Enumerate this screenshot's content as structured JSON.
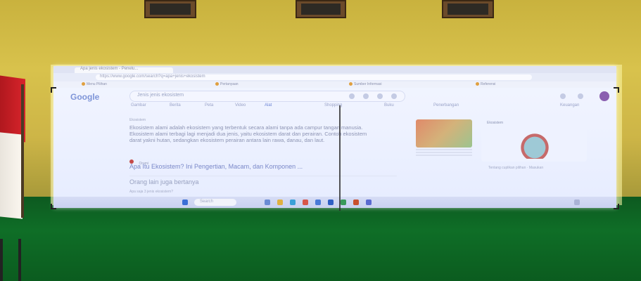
{
  "screen": {
    "tab_title": "Apa jenis ekosistem - Penelu...",
    "url_text": "https://www.google.com/search?q=apa+jenis+ekosistem",
    "bookmarks": [
      "Menu Pilihan",
      "Pertanyaan",
      "Sumber Informasi",
      "Referensi"
    ],
    "logo": "Google",
    "query": "Jenis jenis ekosistem",
    "nav": [
      "Gambar",
      "Berita",
      "Peta",
      "Video",
      "Alat",
      "Shopping",
      "Buku",
      "Penerbangan",
      "Keuangan"
    ],
    "snippet_meta": "Ekosistem",
    "snippet": "Ekosistem alami adalah ekosistem yang terbentuk secara alami tanpa ada campur tangan manusia. Ekosistem alami terbagi lagi menjadi dua jenis, yaitu ekosistem darat dan perairan. Contoh ekosistem darat yakni hutan, sedangkan ekosistem perairan antara lain rawa, danau, dan laut.",
    "source_name": "Orami",
    "result_title": "Apa Itu Ekosistem? Ini Pengertian, Macam, dan Komponen ...",
    "card_title": "Ekosistem",
    "feedback": "Tentang cuplikan pilihan   ·   Masukan",
    "paa_title": "Orang lain juga bertanya",
    "paa_question": "Apa saja 3 jenis ekosistem?",
    "taskbar_search": "Search"
  },
  "colors": {
    "wall": "#d2bb48",
    "floor": "#0f6a25",
    "screen": "#eef2ff",
    "flag_red": "#d8242b"
  }
}
